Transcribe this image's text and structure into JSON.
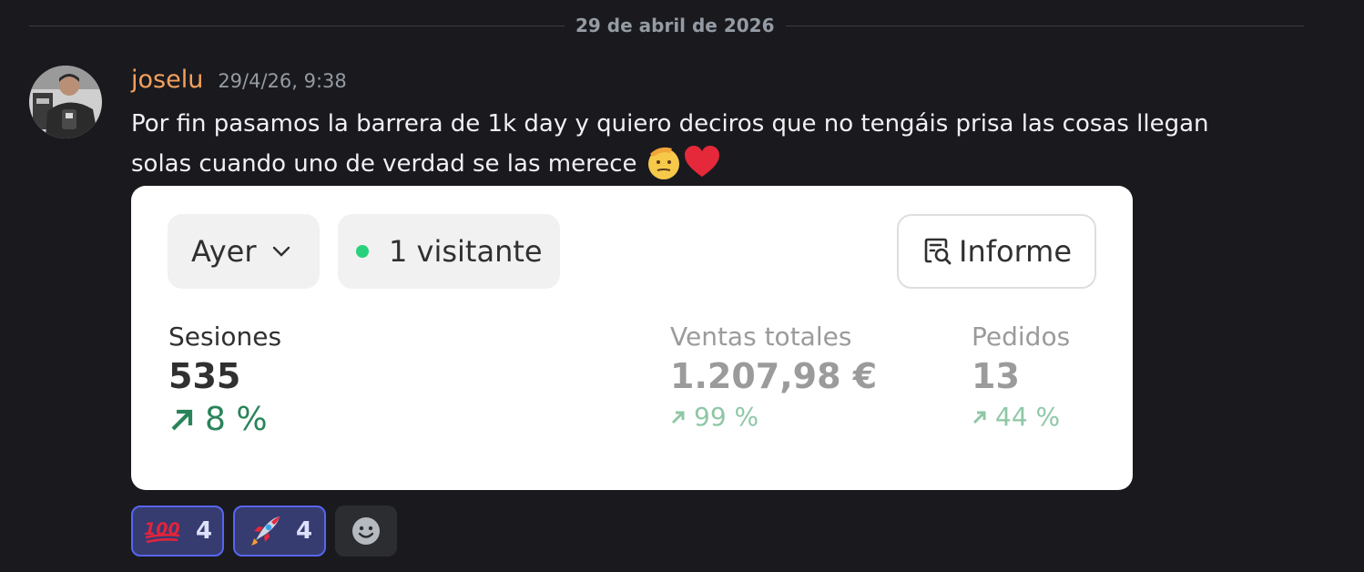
{
  "date_divider": "29 de abril de 2026",
  "message": {
    "author": "joselu",
    "timestamp": "29/4/26, 9:38",
    "line1": "Por fin pasamos la barrera de 1k day y quiero deciros que no tengáis prisa las cosas llegan",
    "line2": "solas cuando uno de verdad se las merece",
    "inline_emojis": [
      "saluting-face",
      "red-heart"
    ]
  },
  "card": {
    "date_filter": "Ayer",
    "visitors": "1 visitante",
    "report_button": "Informe",
    "metrics": [
      {
        "label": "Sesiones",
        "value": "535",
        "change": "8 %"
      },
      {
        "label": "Ventas totales",
        "value": "1.207,98 €",
        "change": "99 %"
      },
      {
        "label": "Pedidos",
        "value": "13",
        "change": "44 %"
      }
    ],
    "colors": {
      "live_dot": "#29d17b",
      "positive_change": "#29845a",
      "positive_change_muted": "#8fc7a6"
    }
  },
  "reactions": [
    {
      "emoji": "hundred-points",
      "count": "4"
    },
    {
      "emoji": "rocket",
      "count": "4"
    }
  ],
  "colors": {
    "author_name": "#f5a15d",
    "reaction_active_bg": "#363b70",
    "reaction_active_border": "#5865f2"
  }
}
